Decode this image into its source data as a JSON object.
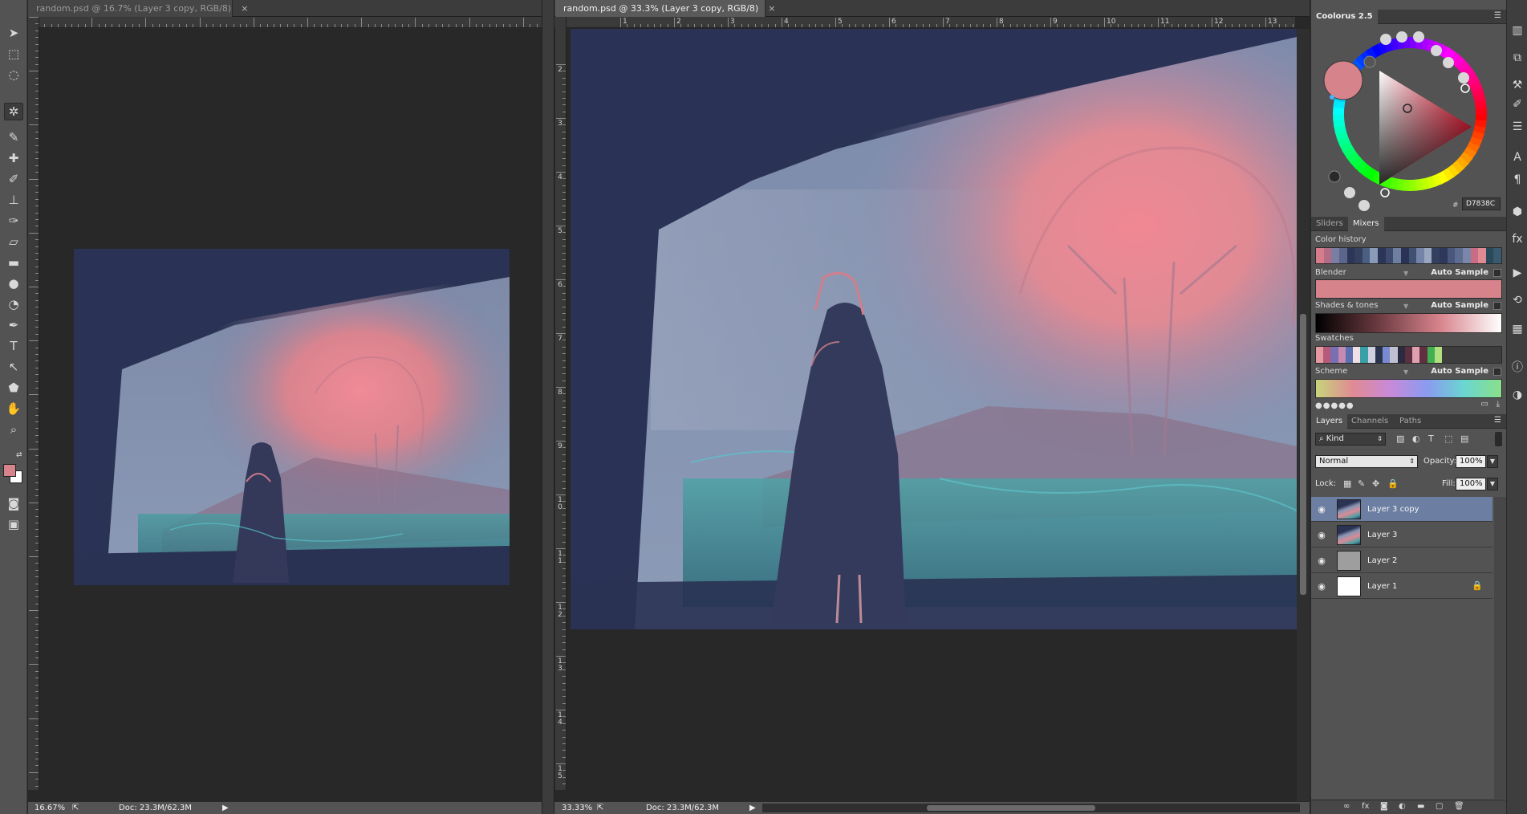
{
  "colors": {
    "ui_dark": "#282828",
    "ui_panel": "#535353",
    "foreground_color": "#D7838C",
    "layer_selected": "#6c7fa3"
  },
  "toolbar": {
    "tools": [
      {
        "name": "move-tool-icon",
        "glyph": "➤",
        "active": false
      },
      {
        "name": "marquee-tool-icon",
        "glyph": "⬚",
        "active": false
      },
      {
        "name": "lasso-tool-icon",
        "glyph": "◌",
        "active": false
      },
      {
        "name": "coolorus-panel-icon",
        "glyph": "✲",
        "active": true
      },
      {
        "name": "eyedropper-tool-icon",
        "glyph": "✎",
        "active": false
      },
      {
        "name": "healing-brush-icon",
        "glyph": "✚",
        "active": false
      },
      {
        "name": "brush-tool-icon",
        "glyph": "✐",
        "active": false
      },
      {
        "name": "clone-stamp-icon",
        "glyph": "⊥",
        "active": false
      },
      {
        "name": "history-brush-icon",
        "glyph": "✑",
        "active": false
      },
      {
        "name": "eraser-tool-icon",
        "glyph": "▱",
        "active": false
      },
      {
        "name": "gradient-tool-icon",
        "glyph": "▬",
        "active": false
      },
      {
        "name": "blur-tool-icon",
        "glyph": "●",
        "active": false
      },
      {
        "name": "dodge-tool-icon",
        "glyph": "◔",
        "active": false
      },
      {
        "name": "pen-tool-icon",
        "glyph": "✒",
        "active": false
      },
      {
        "name": "type-tool-icon",
        "glyph": "T",
        "active": false
      },
      {
        "name": "path-selection-icon",
        "glyph": "↖",
        "active": false
      },
      {
        "name": "shape-tool-icon",
        "glyph": "⬟",
        "active": false
      },
      {
        "name": "hand-tool-icon",
        "glyph": "✋",
        "active": false
      },
      {
        "name": "zoom-tool-icon",
        "glyph": "⌕",
        "active": false
      }
    ],
    "bottom_icons": [
      {
        "name": "quick-mask-icon",
        "glyph": "◙"
      },
      {
        "name": "screen-mode-icon",
        "glyph": "▣"
      }
    ]
  },
  "doc_left": {
    "tab_title": "random.psd @ 16.7% (Layer 3 copy, RGB/8)",
    "close": "×",
    "zoom": "16.67%",
    "doc_size": "Doc: 23.3M/62.3M",
    "status_arrow": "▶"
  },
  "doc_right": {
    "tab_title": "random.psd @ 33.3% (Layer 3 copy, RGB/8)",
    "close": "×",
    "zoom": "33.33%",
    "doc_size": "Doc: 23.3M/62.3M",
    "status_arrow": "▶",
    "ruler_h": [
      "1",
      "2",
      "3",
      "4",
      "5",
      "6",
      "7",
      "8",
      "9",
      "10",
      "11",
      "12",
      "13"
    ],
    "ruler_v": [
      "2",
      "3",
      "4",
      "5",
      "6",
      "7",
      "8",
      "9",
      "10",
      "11",
      "12",
      "13",
      "14",
      "15"
    ]
  },
  "coolorus": {
    "title": "Coolorus 2.5",
    "hex": "D7838C",
    "hash": "#"
  },
  "mixers": {
    "tabs": [
      "Sliders",
      "Mixers"
    ],
    "color_history_label": "Color history",
    "blender_label": "Blender",
    "shades_label": "Shades & tones",
    "swatches_label": "Swatches",
    "scheme_label": "Scheme",
    "auto_sample": "Auto Sample",
    "color_history": [
      "#d77c8a",
      "#b46b85",
      "#7b7ea3",
      "#5a668c",
      "#2c3657",
      "#34405e",
      "#4a5f82",
      "#8a9bb8",
      "#2b3459",
      "#3f4b6e",
      "#6f7fa0",
      "#2a3356",
      "#405070",
      "#7484a8",
      "#9aa6c0",
      "#344060",
      "#2e385a",
      "#4b567c",
      "#5d6d90",
      "#7a87a8",
      "#c86d84",
      "#e08a93",
      "#284a5a",
      "#3a5a70"
    ],
    "swatches": [
      "#e59aa2",
      "#b45a7a",
      "#7a6fb0",
      "#c48ab0",
      "#5a70b0",
      "#f0e0e6",
      "#3aa0a8",
      "#d0d0e0",
      "#2a3450",
      "#7a8ad0",
      "#c0c0d0",
      "#2b2b40",
      "#5a3040",
      "#e0a0b0",
      "#603040",
      "#40b050",
      "#b0e080"
    ]
  },
  "layers": {
    "tabs": [
      "Layers",
      "Channels",
      "Paths"
    ],
    "filter": "Kind",
    "blend_mode": "Normal",
    "opacity_label": "Opacity:",
    "opacity": "100%",
    "fill_label": "Fill:",
    "fill": "100%",
    "lock_label": "Lock:",
    "rows": [
      {
        "name": "Layer 3 copy",
        "selected": true,
        "thumb": "painting",
        "locked": false
      },
      {
        "name": "Layer 3",
        "selected": false,
        "thumb": "painting",
        "locked": false
      },
      {
        "name": "Layer 2",
        "selected": false,
        "thumb": "#9e9e9e",
        "locked": false
      },
      {
        "name": "Layer 1",
        "selected": false,
        "thumb": "#ffffff",
        "locked": true
      }
    ],
    "footer_icons": [
      "link-layers-icon",
      "fx-icon",
      "mask-icon",
      "adjustment-icon",
      "group-icon",
      "new-layer-icon",
      "delete-layer-icon"
    ],
    "footer_glyphs": [
      "∞",
      "fx",
      "◙",
      "◐",
      "▬",
      "▢",
      "🗑"
    ]
  },
  "sidebar_icons": [
    {
      "name": "brush-presets-icon",
      "glyph": "▥"
    },
    {
      "name": "clone-source-icon",
      "glyph": "⧉"
    },
    {
      "name": "tool-presets-icon",
      "glyph": "⚒"
    },
    {
      "name": "brush-settings-icon",
      "glyph": "✐"
    },
    {
      "name": "adjustments-icon",
      "glyph": "☰"
    },
    {
      "name": "character-icon",
      "glyph": "A"
    },
    {
      "name": "paragraph-icon",
      "glyph": "¶"
    },
    {
      "name": "3d-icon",
      "glyph": "⬢"
    },
    {
      "name": "styles-icon",
      "glyph": "fx"
    },
    {
      "name": "actions-icon",
      "glyph": "▶"
    },
    {
      "name": "timeline-icon",
      "glyph": "⟲"
    },
    {
      "name": "properties-icon",
      "glyph": "▦"
    },
    {
      "name": "info-icon",
      "glyph": "ⓘ"
    },
    {
      "name": "navigator-icon",
      "glyph": "◑"
    }
  ]
}
